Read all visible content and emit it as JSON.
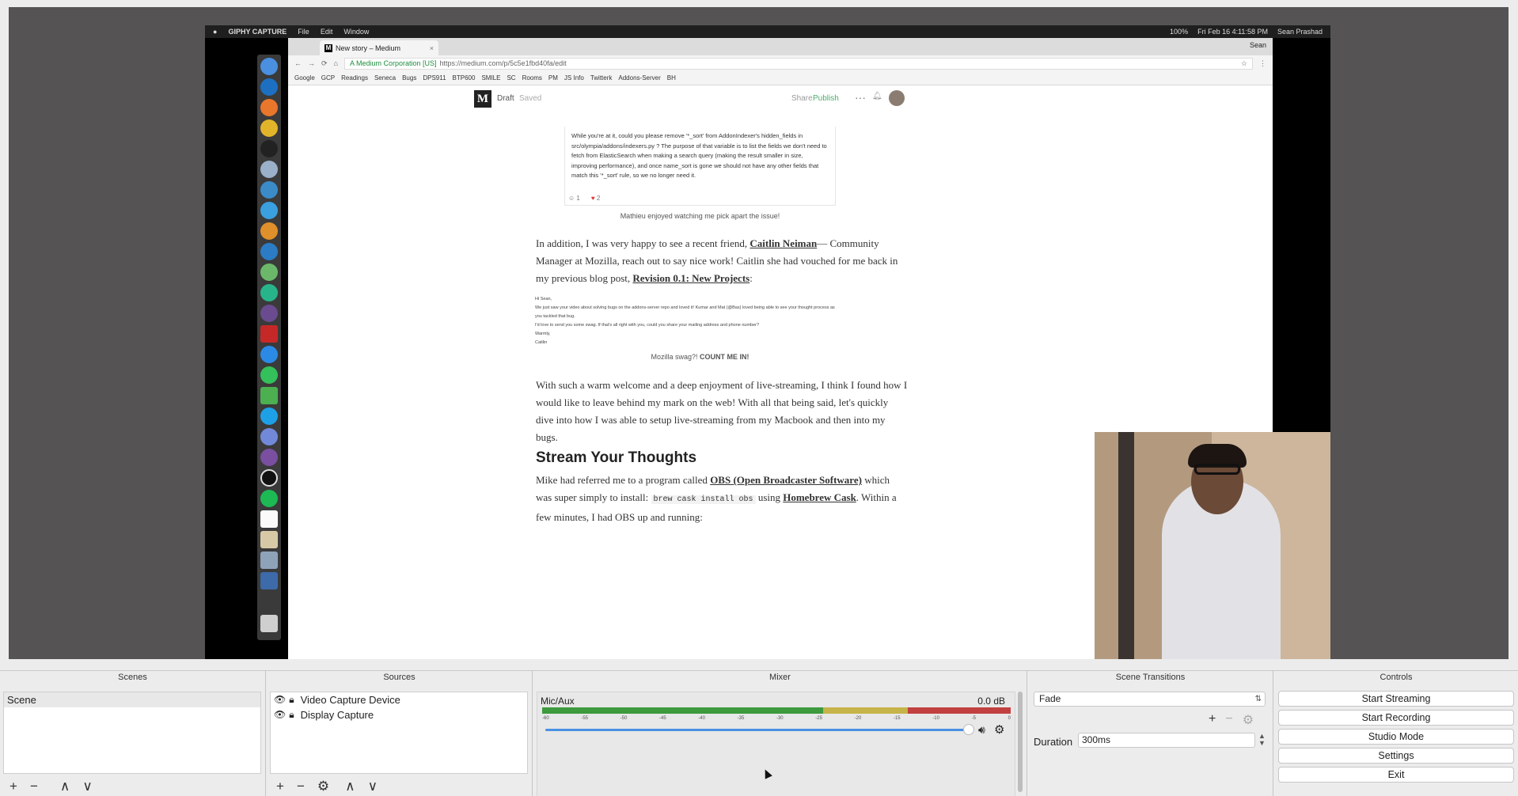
{
  "colors": {
    "obs_bg": "#ececec",
    "preview_bg": "#555353",
    "medium_green": "#4caf6a",
    "meter_green": "#3d9a3d",
    "meter_yellow": "#c6b44a",
    "meter_red": "#c24040",
    "fader_blue": "#4a90e2"
  },
  "mac_menubar": {
    "apple": "",
    "app": "GIPHY CAPTURE",
    "menus": [
      "File",
      "Edit",
      "Window"
    ],
    "battery": "100%",
    "datetime": "Fri Feb 16 4:11:58 PM",
    "user": "Sean Prashad"
  },
  "browser": {
    "tab_title": "New story – Medium",
    "tab_favicon": "M",
    "tab_close": "×",
    "profile": "Sean",
    "secure_label": "A Medium Corporation [US]",
    "url": "https://medium.com/p/5c5e1fbd40fa/edit",
    "bookmarks": [
      "Google",
      "GCP",
      "Readings",
      "Seneca",
      "Bugs",
      "DPS911",
      "BTP600",
      "SMILE",
      "SC",
      "Rooms",
      "PM",
      "JS Info",
      "Twitterk",
      "Addons-Server",
      "BH"
    ]
  },
  "medium": {
    "logo": "M",
    "draft": "Draft",
    "saved": "Saved",
    "share": "Share",
    "publish": "Publish",
    "comment_text": "While you're at it, could you please remove '*_sort' from AddonIndexer's hidden_fields in src/olympia/addons/indexers.py ? The purpose of that variable is to list the fields we don't need to fetch from ElasticSearch when making a search query (making the result smaller in size, improving performance), and once name_sort is gone we should not have any other fields that match this '*_sort' rule, so we no longer need it.",
    "reaction_smile": "1",
    "reaction_heart": "2",
    "caption1": "Mathieu enjoyed watching me pick apart the issue!",
    "p1_a": "In addition, I was very happy to see a recent friend, ",
    "p1_link1": "Caitlin Neiman",
    "p1_b": "— Community Manager at Mozilla, reach out to say nice work! Caitlin she had vouched for me back in my previous blog post, ",
    "p1_link2": "Revision 0.1: New Projects",
    "p1_c": ":",
    "email_lines": [
      "Hi Sean,",
      "We just saw your video about solving bugs on the addons-server repo and loved it! Kumar and Mat (@Bas) loved being able to see your thought process as you tackled that bug.",
      "I'd love to send you some swag. If that's all right with you, could you share your mailing address and phone number?",
      "Warmly,",
      "Caitlin"
    ],
    "caption2_a": "Mozilla swag?! ",
    "caption2_b": "COUNT ME IN!",
    "p2": "With such a warm welcome and a deep enjoyment of live-streaming, I think I found how I would like to leave behind my mark on the web! With all that being said, let's quickly dive into how I was able to setup live-streaming from my Macbook and then into my bugs.",
    "heading": "Stream Your Thoughts",
    "p3_a": "Mike had referred me to a program called ",
    "p3_link1": "OBS (Open Broadcaster Software)",
    "p3_b": " which was super simply to install: ",
    "p3_code": "brew cask install obs",
    "p3_c": " using ",
    "p3_link2": "Homebrew Cask",
    "p3_d": ". Within a few minutes, I had OBS up and running:"
  },
  "obs": {
    "scenes": {
      "title": "Scenes",
      "items": [
        "Scene"
      ]
    },
    "sources": {
      "title": "Sources",
      "items": [
        "Video Capture Device",
        "Display Capture"
      ]
    },
    "mixer": {
      "title": "Mixer",
      "channel": "Mic/Aux",
      "level": "0.0 dB",
      "ticks": [
        "-60",
        "-55",
        "-50",
        "-45",
        "-40",
        "-35",
        "-30",
        "-25",
        "-20",
        "-15",
        "-10",
        "-5",
        "0"
      ],
      "volume_fraction": 0.99
    },
    "transitions": {
      "title": "Scene Transitions",
      "selected": "Fade",
      "duration_label": "Duration",
      "duration_value": "300ms"
    },
    "controls": {
      "title": "Controls",
      "buttons": [
        "Start Streaming",
        "Start Recording",
        "Studio Mode",
        "Settings",
        "Exit"
      ]
    },
    "toolbar": {
      "add": "+",
      "remove": "−",
      "settings": "⚙",
      "up": "∧",
      "down": "∨"
    }
  }
}
